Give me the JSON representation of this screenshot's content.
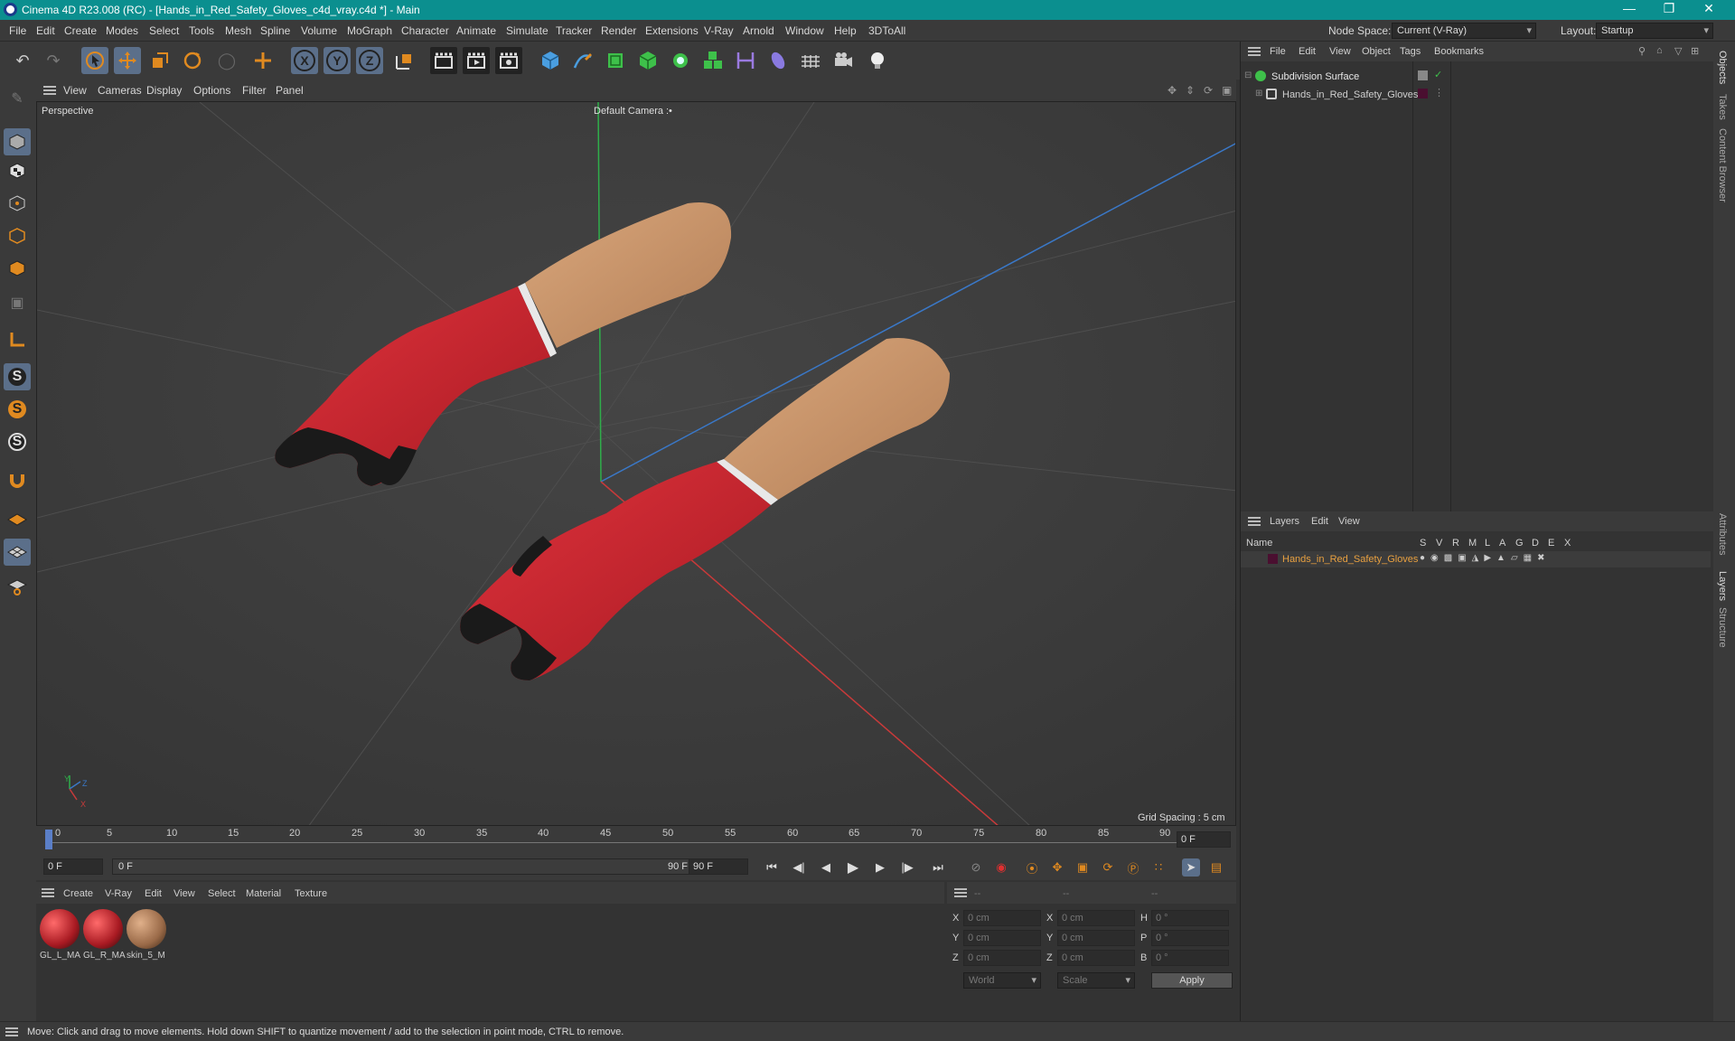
{
  "window": {
    "title": "Cinema 4D R23.008 (RC) - [Hands_in_Red_Safety_Gloves_c4d_vray.c4d *] - Main",
    "controls": [
      "—",
      "❐",
      "✕"
    ]
  },
  "menu": [
    "File",
    "Edit",
    "Create",
    "Modes",
    "Select",
    "Tools",
    "Mesh",
    "Spline",
    "Volume",
    "MoGraph",
    "Character",
    "Animate",
    "Simulate",
    "Tracker",
    "Render",
    "Extensions",
    "V-Ray",
    "Arnold",
    "Window",
    "Help",
    "3DToAll"
  ],
  "node_space": {
    "label": "Node Space:",
    "value": "Current (V-Ray)"
  },
  "layout": {
    "label": "Layout:",
    "value": "Startup"
  },
  "toolbar": {
    "undo": "↶",
    "redo": "↷",
    "axis_x": "X",
    "axis_y": "Y",
    "axis_z": "Z"
  },
  "viewport_menu": [
    "View",
    "Cameras",
    "Display",
    "Options",
    "Filter",
    "Panel"
  ],
  "viewport": {
    "name": "Perspective",
    "camera": "Default Camera",
    "camera_mark": ":•",
    "grid_spacing": "Grid Spacing : 5 cm",
    "axis_x": "X",
    "axis_y": "Y",
    "axis_z": "Z"
  },
  "timeline": {
    "ticks": [
      "0",
      "5",
      "10",
      "15",
      "20",
      "25",
      "30",
      "35",
      "40",
      "45",
      "50",
      "55",
      "60",
      "65",
      "70",
      "75",
      "80",
      "85",
      "90"
    ],
    "current_frame": "0 F",
    "start_frame": "0 F",
    "range_start": "0 F",
    "range_end": "90 F",
    "end_frame": "90 F"
  },
  "material_menu": [
    "Create",
    "V-Ray",
    "Edit",
    "View",
    "Select",
    "Material",
    "Texture"
  ],
  "materials": [
    {
      "name": "GL_L_MA",
      "color": "#b42a2a"
    },
    {
      "name": "GL_R_MA",
      "color": "#b42a2a"
    },
    {
      "name": "skin_5_M",
      "color": "#b88c66"
    }
  ],
  "coords": {
    "headers": [
      "--",
      "--",
      "--"
    ],
    "rows": [
      {
        "a": "X",
        "av": "0 cm",
        "b": "X",
        "bv": "0 cm",
        "c": "H",
        "cv": "0 °"
      },
      {
        "a": "Y",
        "av": "0 cm",
        "b": "Y",
        "bv": "0 cm",
        "c": "P",
        "cv": "0 °"
      },
      {
        "a": "Z",
        "av": "0 cm",
        "b": "Z",
        "bv": "0 cm",
        "c": "B",
        "cv": "0 °"
      }
    ],
    "mode": "World",
    "type": "Scale",
    "apply": "Apply"
  },
  "objects_menu": [
    "File",
    "Edit",
    "View",
    "Object",
    "Tags",
    "Bookmarks"
  ],
  "objects": [
    {
      "name": "Subdivision Surface",
      "color": "#e8e8e8"
    },
    {
      "name": "Hands_in_Red_Safety_Gloves",
      "color": "#cfcfcf"
    }
  ],
  "layers_menu": [
    "Layers",
    "Edit",
    "View"
  ],
  "layers_header": {
    "name": "Name",
    "cols": [
      "S",
      "V",
      "R",
      "M",
      "L",
      "A",
      "G",
      "D",
      "E",
      "X"
    ]
  },
  "layers": [
    {
      "name": "Hands_in_Red_Safety_Gloves",
      "color": "#e8a040"
    }
  ],
  "side_tabs": [
    "Objects",
    "Takes",
    "Content Browser",
    "Attributes",
    "Layers",
    "Structure"
  ],
  "status": "Move: Click and drag to move elements. Hold down SHIFT to quantize movement / add to the selection in point mode, CTRL to remove.",
  "colors": {
    "accent": "#0b8f8f",
    "selected_tool": "#5b6f8a",
    "layer_name": "#e8a040",
    "layer_swatch": "#4a0f30"
  }
}
